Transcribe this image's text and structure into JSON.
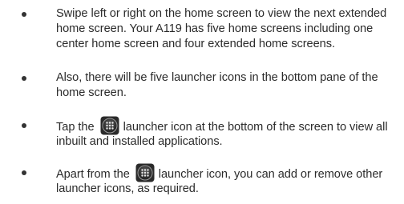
{
  "items": [
    {
      "lines": [
        "Swipe left or right on the home screen to view the next extended",
        "home screen. Your A119 has five home screens including one",
        "center home screen and four extended home screens."
      ]
    },
    {
      "lines": [
        "Also, there will be five launcher icons in the bottom pane of the",
        "home screen."
      ]
    },
    {
      "line1_before": "Tap the",
      "line1_after": "launcher icon at the bottom of the screen to view all",
      "line2": "inbuilt and installed applications.",
      "icon": "app-launcher-icon"
    },
    {
      "line1_before": "Apart from the",
      "line1_after": "launcher icon, you can add or remove other",
      "line2": "launcher icons, as required.",
      "icon": "app-launcher-icon"
    }
  ],
  "colors": {
    "text": "#2b2b2b",
    "bullet": "#333333",
    "icon_bg": "#2a2a2a",
    "icon_dots": "#e6e6e6"
  }
}
